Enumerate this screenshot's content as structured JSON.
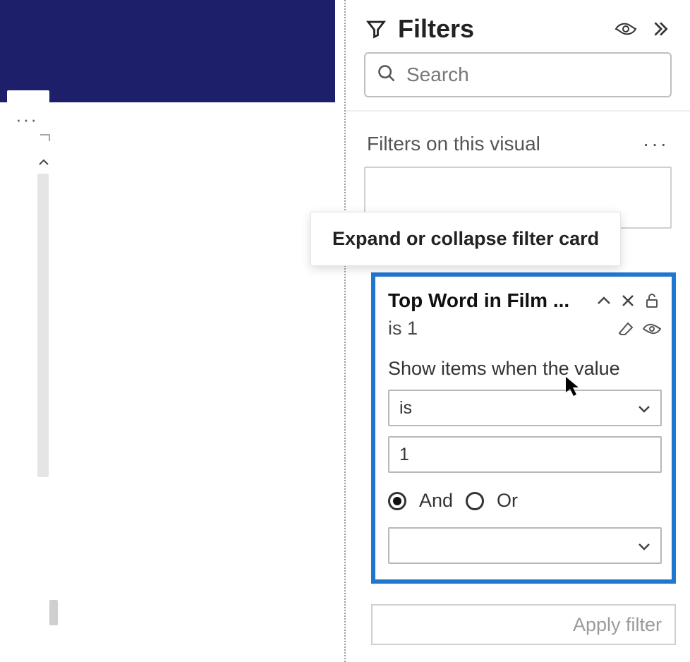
{
  "pane": {
    "title": "Filters",
    "search_placeholder": "Search",
    "section_title": "Filters on this visual"
  },
  "tooltip": "Expand or collapse filter card",
  "card": {
    "title": "Top Word in Film ...",
    "summary": "is 1",
    "prompt": "Show items when the value",
    "operator": "is",
    "value": "1",
    "logic_and": "And",
    "logic_or": "Or",
    "logic_selected": "and",
    "operator2": ""
  },
  "apply_label": "Apply filter"
}
